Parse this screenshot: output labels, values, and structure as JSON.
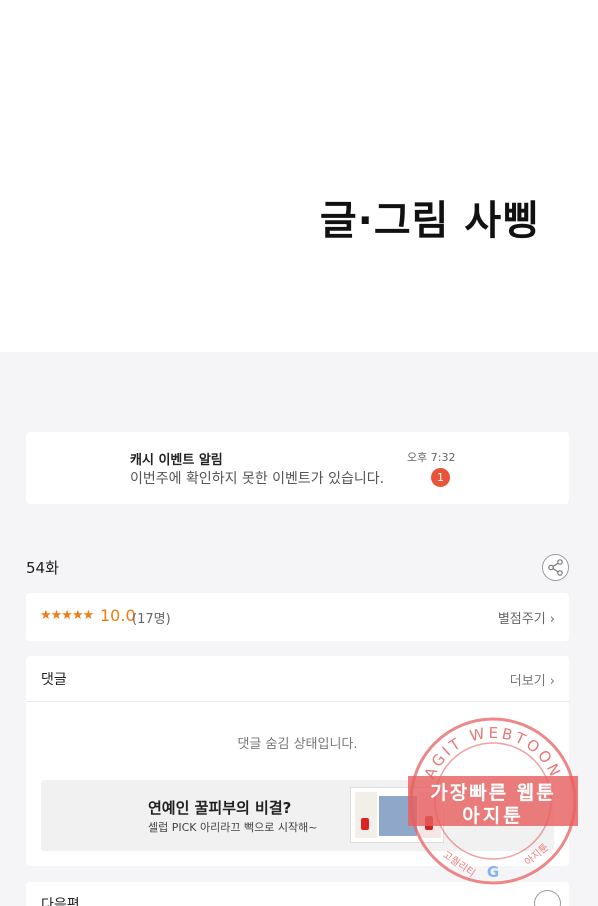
{
  "hero": {
    "credit": "글·그림  사삥"
  },
  "notice": {
    "title": "캐시 이벤트 알림",
    "message": "이번주에 확인하지 못한 이벤트가 있습니다.",
    "time": "오후 7:32",
    "badge_count": "1"
  },
  "episode": {
    "title": "54화",
    "share_icon": "share-icon"
  },
  "rating": {
    "stars": "★★★★★",
    "score": "10.0",
    "count": "(17명)",
    "rate_label": "별점주기 ›"
  },
  "comments": {
    "label": "댓글",
    "more_label": "더보기 ›",
    "hidden_message": "댓글 숨김 상태입니다."
  },
  "ad": {
    "title": "연예인 꿀피부의 비결?",
    "subtitle": "셀럽 PICK 아리라끄 뻑으로 시작해~"
  },
  "next": {
    "label": "다음편"
  },
  "watermark": {
    "ring_text": "AGIT WEBTOON",
    "line1": "가장빠른 웹툰",
    "line2": "아지툰",
    "bottom_left": "고퀄리티",
    "bottom_right": "아지툰",
    "color": "#e86060"
  }
}
